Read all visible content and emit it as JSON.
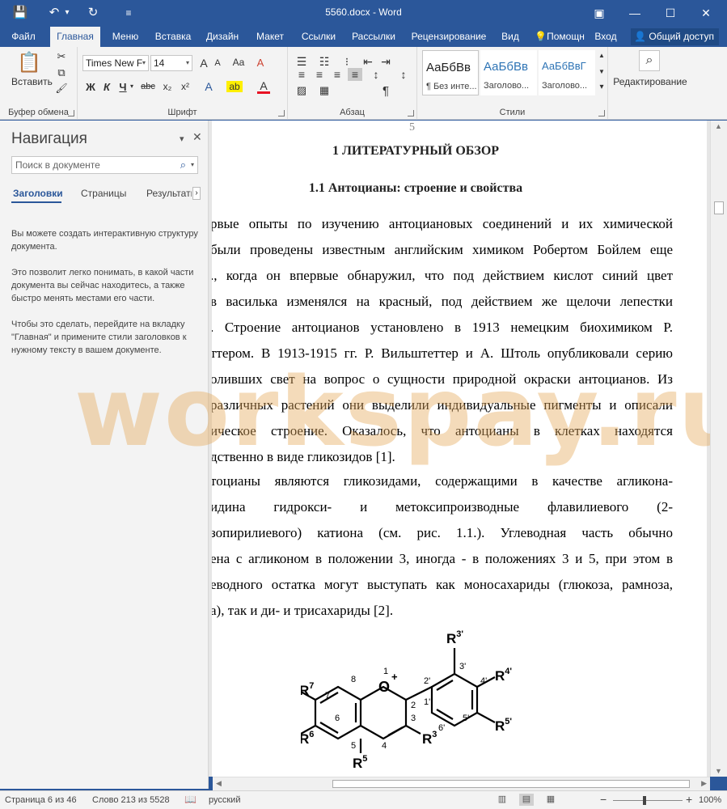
{
  "titlebar": {
    "title": "5560.docx - Word",
    "save_icon": "💾",
    "undo_icon": "↶",
    "undo_dd": "▾",
    "redo_icon": "↻",
    "qat_icon": "≡",
    "ribbon_opt_icon": "▣",
    "minimize_icon": "—",
    "maximize_icon": "☐",
    "close_icon": "✕"
  },
  "tabs": {
    "items": [
      "Файл",
      "Главная",
      "Меню",
      "Вставка",
      "Дизайн",
      "Макет",
      "Ссылки",
      "Рассылки",
      "Рецензирование",
      "Вид"
    ],
    "help": "Помощн",
    "signin": "Вход",
    "share": "Общий доступ"
  },
  "ribbon": {
    "clipboard": {
      "paste": "Вставить",
      "label": "Буфер обмена",
      "paste_icon": "📋",
      "cut_icon": "✂",
      "copy_icon": "⧉",
      "painter_icon": "🖌"
    },
    "font": {
      "name": "Times New F",
      "size": "14",
      "label": "Шрифт",
      "grow": "A",
      "shrink": "A",
      "case": "Aa",
      "clear": "A",
      "bold": "Ж",
      "italic": "К",
      "underline": "Ч",
      "strike": "abc",
      "sub": "x₂",
      "sup": "x²",
      "effects": "A",
      "highlight": "ab",
      "color": "A",
      "dd": "▾"
    },
    "paragraph": {
      "label": "Абзац",
      "bullets": "☰",
      "numbering": "☷",
      "multilevel": "⁝",
      "indent_less": "⇤",
      "indent_more": "⇥",
      "sort": "↕",
      "marks": "¶",
      "align_left": "≡",
      "align_center": "≡",
      "align_right": "≡",
      "justify": "≡",
      "spacing": "↕",
      "shading": "▨",
      "borders": "▦"
    },
    "styles": {
      "label": "Стили",
      "tiles": [
        {
          "sample": "АаБбВв",
          "name": "¶ Без инте..."
        },
        {
          "sample": "АаБбВв",
          "name": "Заголово..."
        },
        {
          "sample": "АаБбВвГ",
          "name": "Заголово..."
        }
      ],
      "scroll_up": "▲",
      "scroll_down": "▼",
      "more": "▾"
    },
    "editing": {
      "label": "Редактирование",
      "find_icon": "⌕"
    }
  },
  "nav": {
    "title": "Навигация",
    "menu_icon": "▾",
    "close_icon": "✕",
    "search_placeholder": "Поиск в документе",
    "search_icon": "⌕",
    "search_dd": "▾",
    "tabs": [
      "Заголовки",
      "Страницы",
      "Результать"
    ],
    "tab_more": "›",
    "hint1": "Вы можете создать интерактивную структуру документа.",
    "hint2": "Это позволит легко понимать, в какой части документа вы сейчас находитесь, а также быстро менять местами его части.",
    "hint3": "Чтобы это сделать, перейдите на вкладку \"Главная\" и примените стили заголовков к нужному тексту в вашем документе."
  },
  "document": {
    "page_number": "5",
    "chapter_title": "1 ЛИТЕРАТУРНЫЙ ОБЗОР",
    "section_title": "1.1  Антоцианы: строение и свойства",
    "lines": [
      "рвые опыты по изучению антоциановых соединений и их химической",
      " были проведены известным английским химиком Робертом Бойлем еще",
      "., когда он впервые обнаружил, что под действием кислот синий цвет",
      "в василька изменялся на красный, под действием же щелочи лепестки",
      ". Строение антоцианов установлено в 1913 немецким биохимиком Р.",
      "ттером. В 1913-1915 гг. Р. Вильштеттер и А. Штоль опубликовали серию",
      "оливших свет на вопрос о сущности природной окраски антоцианов. Из",
      "различных растений они выделили индивидуальные пигменты и описали",
      "ическое строение. Оказалось, что антоцианы в клетках находятся",
      "дственно в виде гликозидов [1].",
      "тоцианы являются гликозидами, содержащими в качестве агликона-",
      "идина    гидрокси-    и    метоксипроизводные    флавилиевого    (2-",
      "зопирилиевого) катиона (см. рис. 1.1.). Углеводная часть обычно",
      "ена с агликоном в положении 3, иногда - в положениях 3 и 5, при этом в",
      "еводного остатка могут выступать как моносахариды (глюкоза, рамноза,",
      "а), так и ди- и трисахариды [2]."
    ],
    "structure": {
      "atom_O": "O",
      "charge": "+",
      "num_1": "1",
      "num_2": "2",
      "num_3": "3",
      "num_4": "4",
      "num_5": "5",
      "num_6": "6",
      "num_7": "7",
      "num_8": "8",
      "num_1p": "1'",
      "num_2p": "2'",
      "num_3p": "3'",
      "num_4p": "4'",
      "num_5p": "5'",
      "num_6p": "6'",
      "R": "R",
      "sub_3p": "3'",
      "sub_4p": "4'",
      "sub_5p": "5'",
      "sub_7": "7",
      "sub_6": "6",
      "sub_5": "5",
      "sub_3": "3"
    }
  },
  "watermark": "workspay.ru",
  "scroll": {
    "up": "▲",
    "down": "▼",
    "left": "◀",
    "right": "▶"
  },
  "status": {
    "page": "Страница 6 из 46",
    "words": "Слово 213 из 5528",
    "proof_icon": "📖",
    "language": "русский",
    "zoom_minus": "−",
    "zoom_plus": "+",
    "zoom": "100%",
    "view_read": "▥",
    "view_print": "▤",
    "view_web": "▦",
    "zoom_level": 1.0
  },
  "colors": {
    "accent": "#2b579a",
    "ribbon": "#f3f3f3",
    "watermark": "#e4aa5a"
  }
}
